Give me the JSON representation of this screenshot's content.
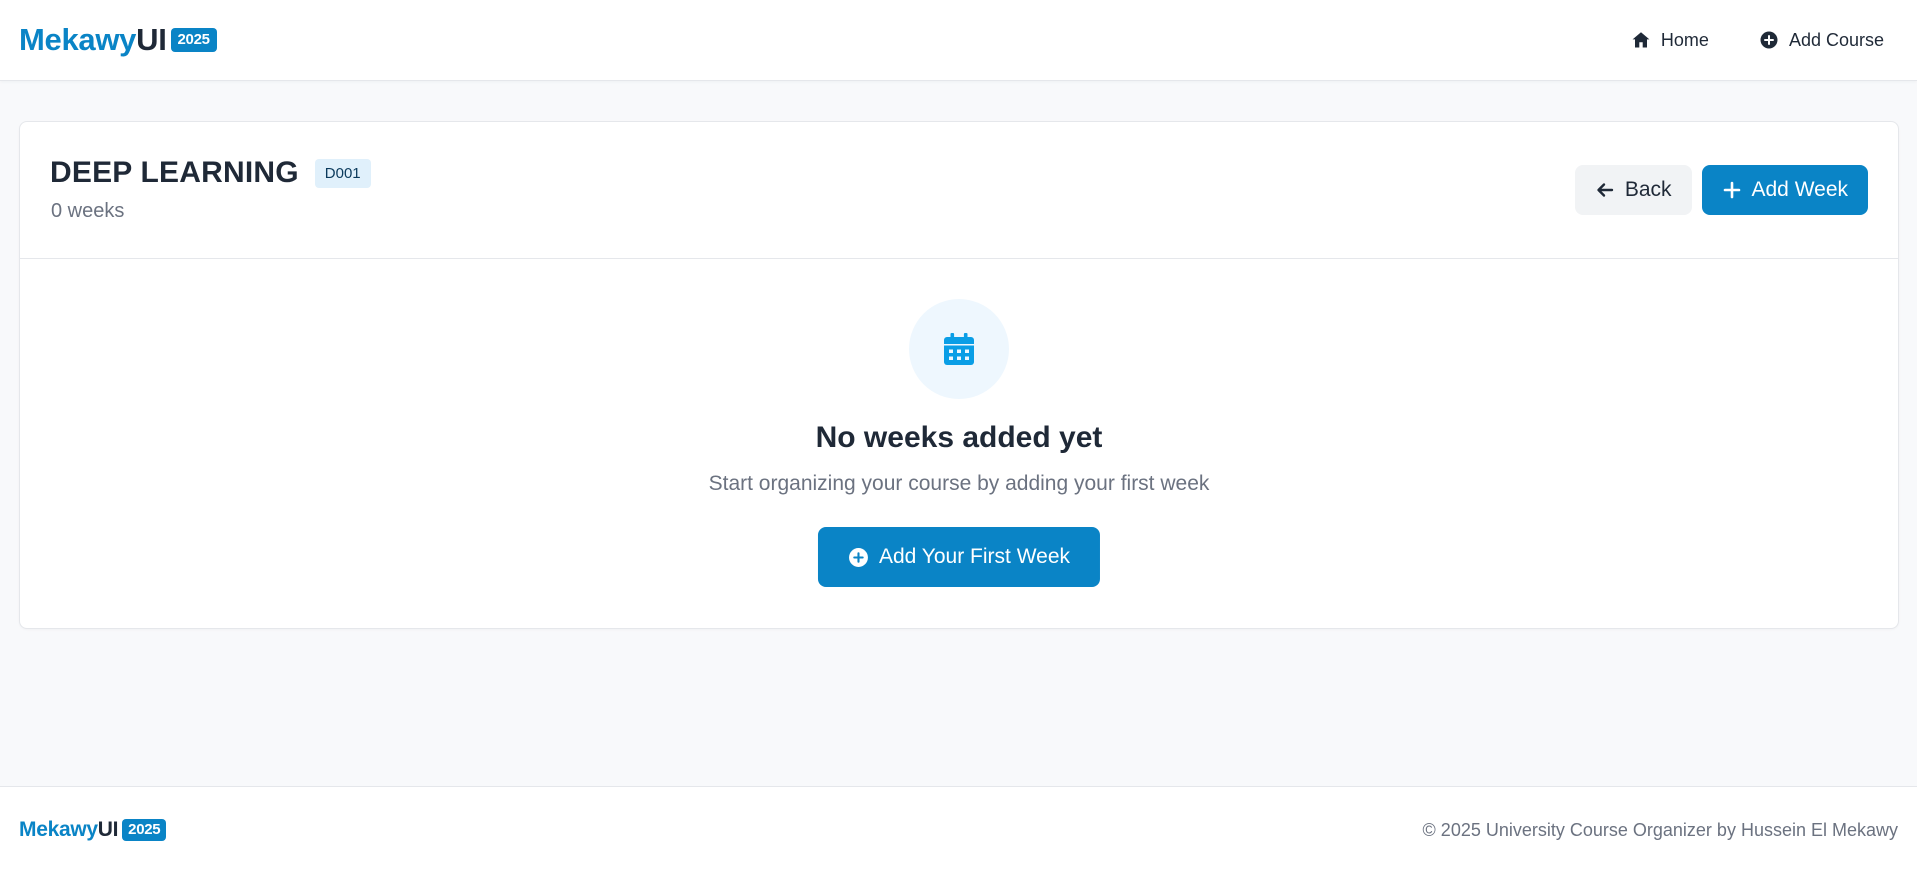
{
  "header": {
    "brand_part1": "Mekawy",
    "brand_part2": "UI",
    "brand_year": "2025",
    "nav": [
      {
        "label": "Home",
        "icon": "home-icon"
      },
      {
        "label": "Add Course",
        "icon": "plus-circle-icon"
      }
    ]
  },
  "course": {
    "title": "DEEP LEARNING",
    "code": "D001",
    "weeks_count": "0 weeks",
    "back_label": "Back",
    "add_week_label": "Add Week"
  },
  "empty_state": {
    "icon": "calendar-icon",
    "title": "No weeks added yet",
    "subtitle": "Start organizing your course by adding your first week",
    "button_label": "Add Your First Week"
  },
  "footer": {
    "brand_part1": "Mekawy",
    "brand_part2": "UI",
    "brand_year": "2025",
    "copyright": "© 2025 University Course Organizer by Hussein El Mekawy"
  },
  "colors": {
    "primary": "#0a84c6",
    "text": "#1f2937",
    "muted": "#6b7280",
    "background": "#f8f9fb"
  }
}
